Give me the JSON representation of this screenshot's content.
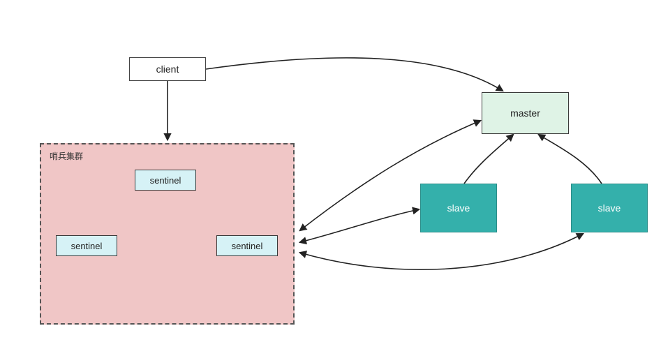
{
  "diagram": {
    "client_label": "client",
    "master_label": "master",
    "slave_label": "slave",
    "sentinel_label": "sentinel",
    "cluster_title": "哨兵集群"
  }
}
